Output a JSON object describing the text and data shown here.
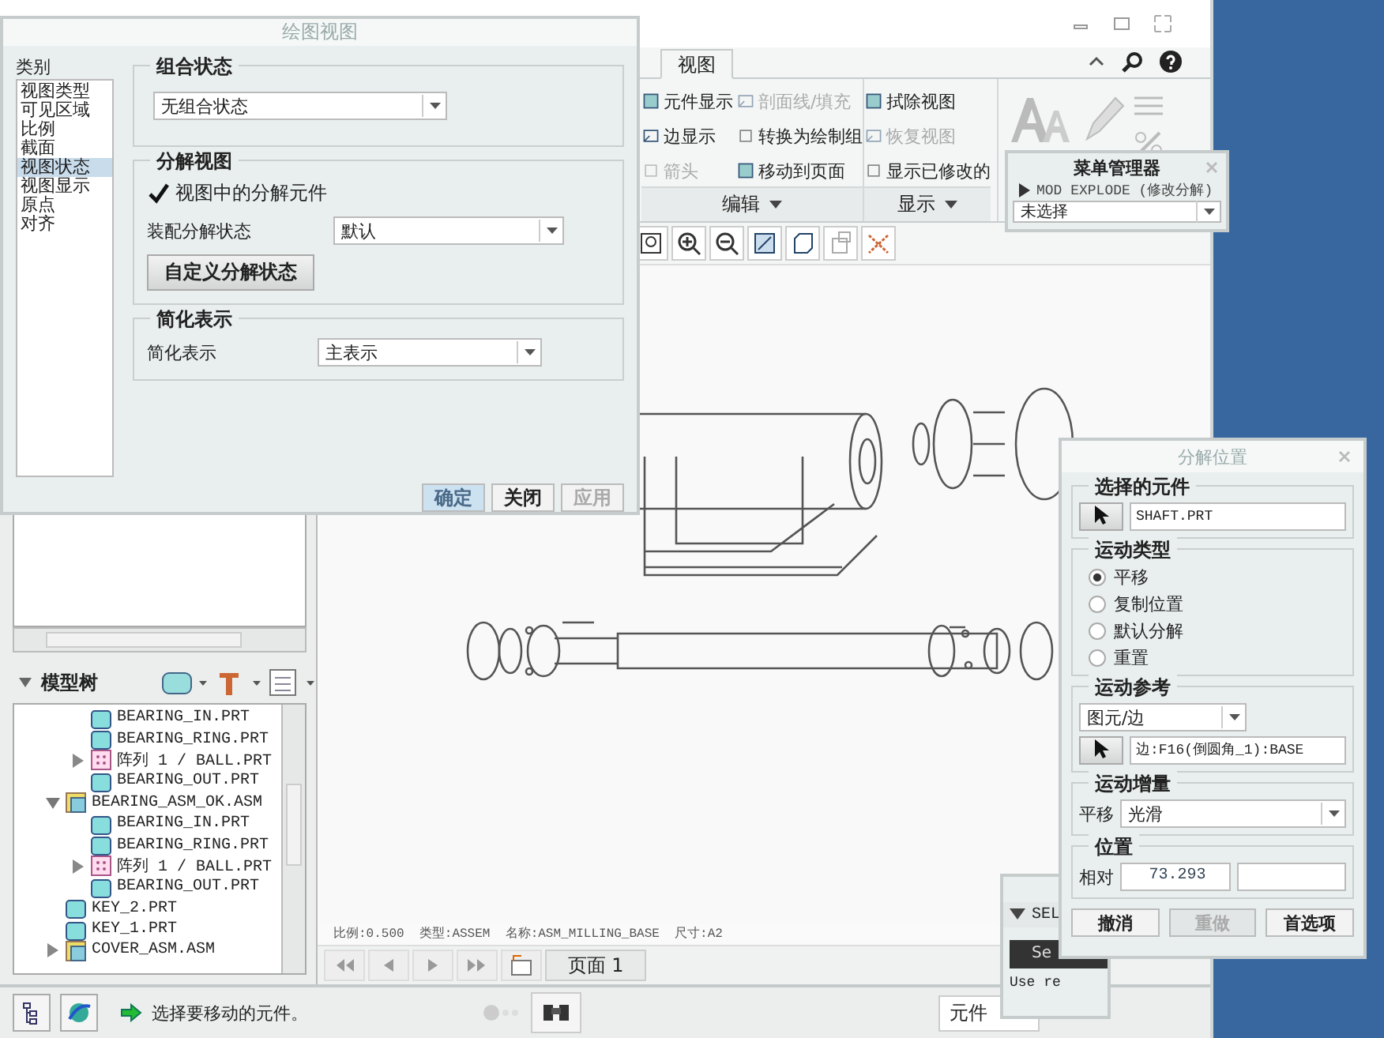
{
  "ribbon": {
    "tabs": [
      {
        "label": "视图",
        "selected": true
      }
    ],
    "groups": [
      {
        "label": "编辑",
        "columns": [
          [
            {
              "label": "元件显示",
              "disabled": false
            },
            {
              "label": "边显示",
              "disabled": false
            },
            {
              "label": "箭头",
              "disabled": true
            }
          ],
          [
            {
              "label": "剖面线/填充",
              "disabled": true
            },
            {
              "label": "转换为绘制组",
              "disabled": false
            },
            {
              "label": "移动到页面",
              "disabled": false
            }
          ]
        ]
      },
      {
        "label": "显示",
        "columns": [
          [
            {
              "label": "拭除视图",
              "disabled": false
            },
            {
              "label": "恢复视图",
              "disabled": true
            },
            {
              "label": "显示已修改的",
              "disabled": false
            }
          ]
        ]
      }
    ]
  },
  "graphics": {
    "info": "比例:0.500  类型:ASSEM  名称:ASM_MILLING_BASE  尺寸:A2",
    "page_tab": "页面 1"
  },
  "model_tree": {
    "title": "模型树",
    "clipped_children": [
      {
        "label": "BEARING_IN.PRT",
        "kind": "part"
      },
      {
        "label": "BEARING_RING.PRT",
        "kind": "part"
      },
      {
        "label": "阵列 1 / BALL.PRT",
        "kind": "pattern",
        "expanded": false
      },
      {
        "label": "BEARING_OUT.PRT",
        "kind": "part"
      }
    ],
    "items": [
      {
        "label": "BEARING_ASM_OK.ASM",
        "kind": "assembly",
        "expanded": true,
        "children": [
          {
            "label": "BEARING_IN.PRT",
            "kind": "part"
          },
          {
            "label": "BEARING_RING.PRT",
            "kind": "part"
          },
          {
            "label": "阵列 1 / BALL.PRT",
            "kind": "pattern",
            "expanded": false
          },
          {
            "label": "BEARING_OUT.PRT",
            "kind": "part"
          }
        ]
      },
      {
        "label": "KEY_2.PRT",
        "kind": "part"
      },
      {
        "label": "KEY_1.PRT",
        "kind": "part"
      },
      {
        "label": "COVER_ASM.ASM",
        "kind": "assembly",
        "expanded": false
      }
    ]
  },
  "status_bar": {
    "message": "选择要移动的元件。",
    "filter": "元件"
  },
  "drawing_view_dialog": {
    "title": "绘图视图",
    "category_label": "类别",
    "categories": [
      {
        "label": "视图类型",
        "selected": false
      },
      {
        "label": "可见区域",
        "selected": false
      },
      {
        "label": "比例",
        "selected": false
      },
      {
        "label": "截面",
        "selected": false
      },
      {
        "label": "视图状态",
        "selected": true
      },
      {
        "label": "视图显示",
        "selected": false
      },
      {
        "label": "原点",
        "selected": false
      },
      {
        "label": "对齐",
        "selected": false
      }
    ],
    "combined_state": {
      "title": "组合状态",
      "value": "无组合状态"
    },
    "explode": {
      "title": "分解视图",
      "checkbox": {
        "label": "视图中的分解元件",
        "checked": true
      },
      "state_label": "装配分解状态",
      "state_value": "默认",
      "custom_button": "自定义分解状态"
    },
    "simplified": {
      "title": "简化表示",
      "label": "简化表示",
      "value": "主表示"
    },
    "buttons": [
      {
        "label": "确定",
        "kind": "default",
        "disabled": false
      },
      {
        "label": "关闭",
        "kind": "normal",
        "disabled": false
      },
      {
        "label": "应用",
        "kind": "normal",
        "disabled": true
      }
    ]
  },
  "menu_manager": {
    "title": "菜单管理器",
    "menu": "MOD EXPLODE (修改分解)",
    "selection": "未选择"
  },
  "sel_menu": {
    "title": "SEL",
    "item": "Se",
    "hint": "Use re"
  },
  "explode_dialog": {
    "title": "分解位置",
    "selected_component": {
      "title": "选择的元件",
      "value": "SHAFT.PRT"
    },
    "motion_type": {
      "title": "运动类型",
      "options": [
        {
          "label": "平移",
          "selected": true
        },
        {
          "label": "复制位置",
          "selected": false
        },
        {
          "label": "默认分解",
          "selected": false
        },
        {
          "label": "重置",
          "selected": false
        }
      ]
    },
    "motion_reference": {
      "title": "运动参考",
      "type": "图元/边",
      "value": "边:F16(倒圆角_1):BASE"
    },
    "motion_increment": {
      "title": "运动增量",
      "label": "平移",
      "value": "光滑"
    },
    "position": {
      "title": "位置",
      "label": "相对",
      "value": "73.293"
    },
    "buttons": [
      {
        "label": "撤消",
        "disabled": false
      },
      {
        "label": "重做",
        "disabled": true
      },
      {
        "label": "首选项",
        "disabled": false
      }
    ]
  }
}
